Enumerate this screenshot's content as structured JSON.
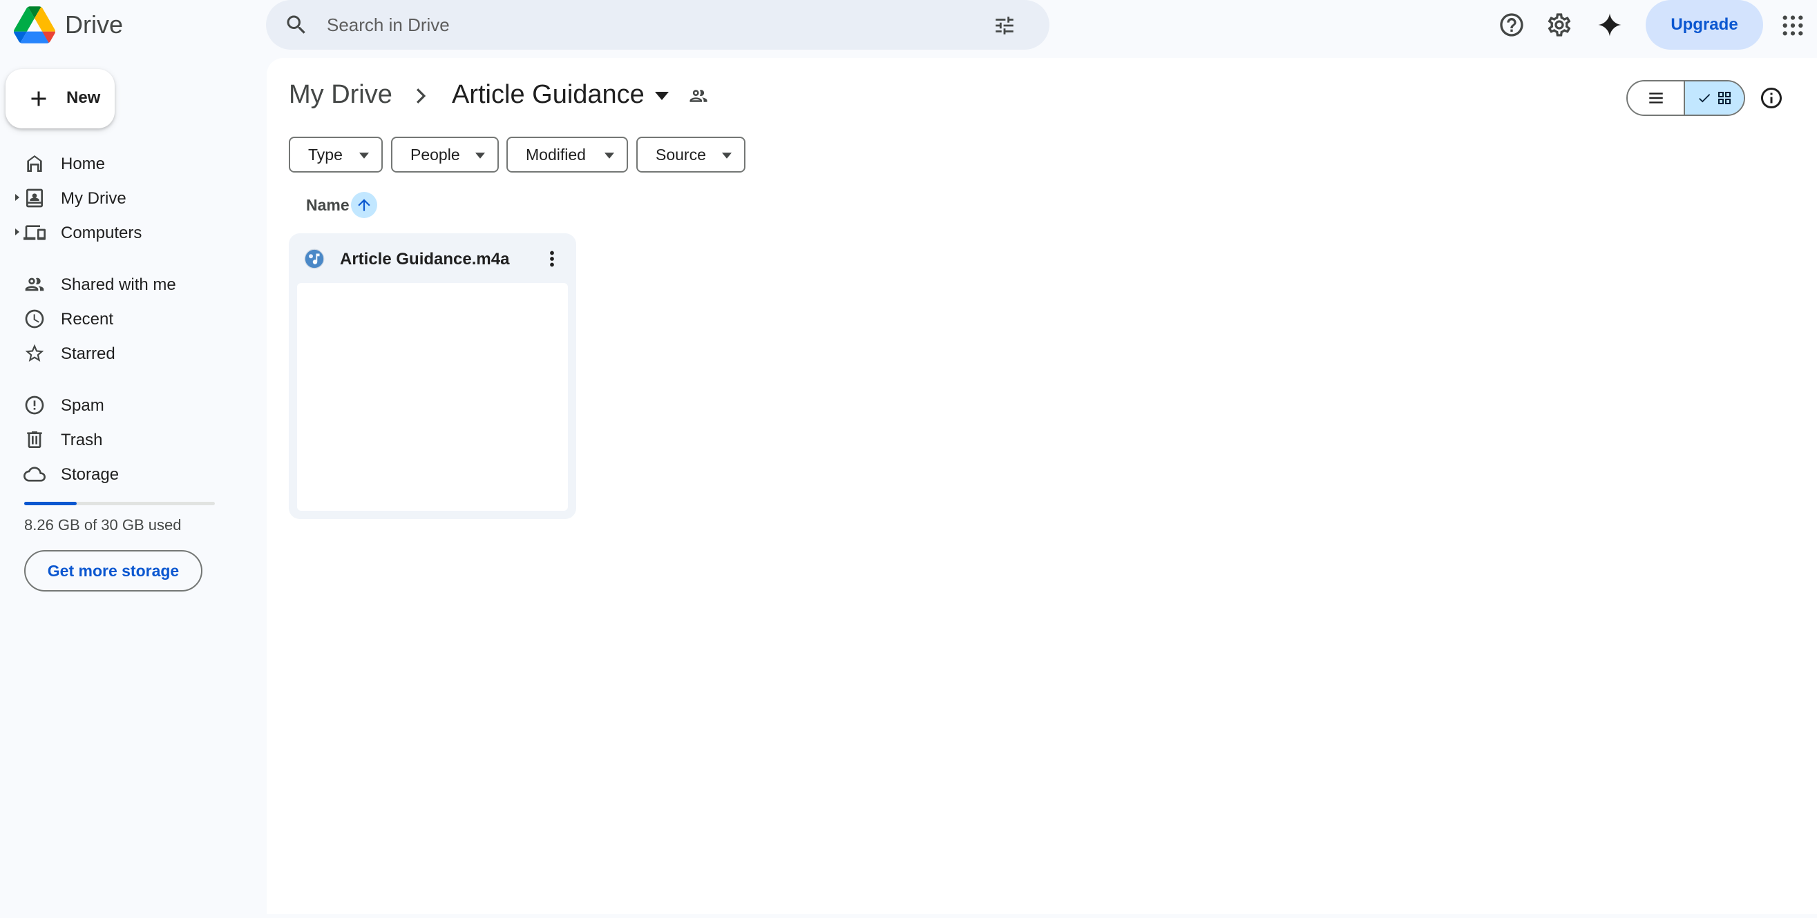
{
  "app": {
    "name": "Drive"
  },
  "search": {
    "placeholder": "Search in Drive"
  },
  "header": {
    "upgrade_label": "Upgrade"
  },
  "sidebar": {
    "new_label": "New",
    "items": [
      {
        "label": "Home",
        "icon": "home-icon"
      },
      {
        "label": "My Drive",
        "icon": "my-drive-icon"
      },
      {
        "label": "Computers",
        "icon": "computers-icon"
      },
      {
        "label": "Shared with me",
        "icon": "shared-icon"
      },
      {
        "label": "Recent",
        "icon": "clock-icon"
      },
      {
        "label": "Starred",
        "icon": "star-icon"
      },
      {
        "label": "Spam",
        "icon": "spam-icon"
      },
      {
        "label": "Trash",
        "icon": "trash-icon"
      },
      {
        "label": "Storage",
        "icon": "cloud-icon"
      }
    ],
    "storage": {
      "used_text": "8.26 GB of 30 GB used",
      "used_fraction": 0.275,
      "button_label": "Get more storage"
    }
  },
  "breadcrumb": {
    "root": "My Drive",
    "current": "Article Guidance"
  },
  "filters": [
    {
      "label": "Type"
    },
    {
      "label": "People"
    },
    {
      "label": "Modified"
    },
    {
      "label": "Source"
    }
  ],
  "sort": {
    "label": "Name",
    "direction": "ascending"
  },
  "files": [
    {
      "name": "Article Guidance.m4a",
      "type": "audio"
    }
  ],
  "colors": {
    "accent": "#0b57d0",
    "selected": "#c2e7ff",
    "background": "#f8fafd",
    "search_bg": "#e9eef6"
  }
}
